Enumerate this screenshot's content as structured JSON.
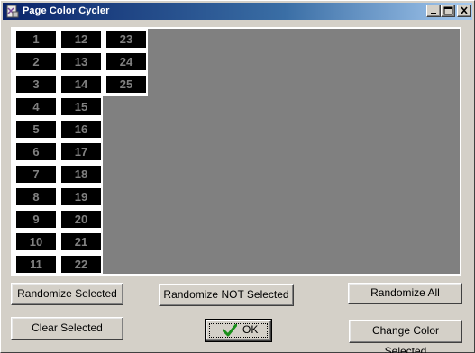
{
  "window": {
    "title": "Page Color Cycler"
  },
  "titlebar_buttons": [
    {
      "name": "minimize-button",
      "icon": "minimize-icon"
    },
    {
      "name": "maximize-button",
      "icon": "maximize-icon"
    },
    {
      "name": "close-button",
      "icon": "close-icon"
    }
  ],
  "colors": {
    "canvas": "#808080",
    "chip_bg": "#000000",
    "chip_text": "#808080",
    "panel": "#ffffff",
    "ok_check": "#1a8f1a"
  },
  "pages": [
    "1",
    "2",
    "3",
    "4",
    "5",
    "6",
    "7",
    "8",
    "9",
    "10",
    "11",
    "12",
    "13",
    "14",
    "15",
    "16",
    "17",
    "18",
    "19",
    "20",
    "21",
    "22",
    "23",
    "24",
    "25"
  ],
  "buttons": {
    "randomize_selected": "Randomize Selected",
    "randomize_not_selected": "Randomize NOT Selected",
    "randomize_all": "Randomize All",
    "clear_selected": "Clear Selected",
    "ok": "OK",
    "change_color_selected": "Change Color Selected"
  }
}
